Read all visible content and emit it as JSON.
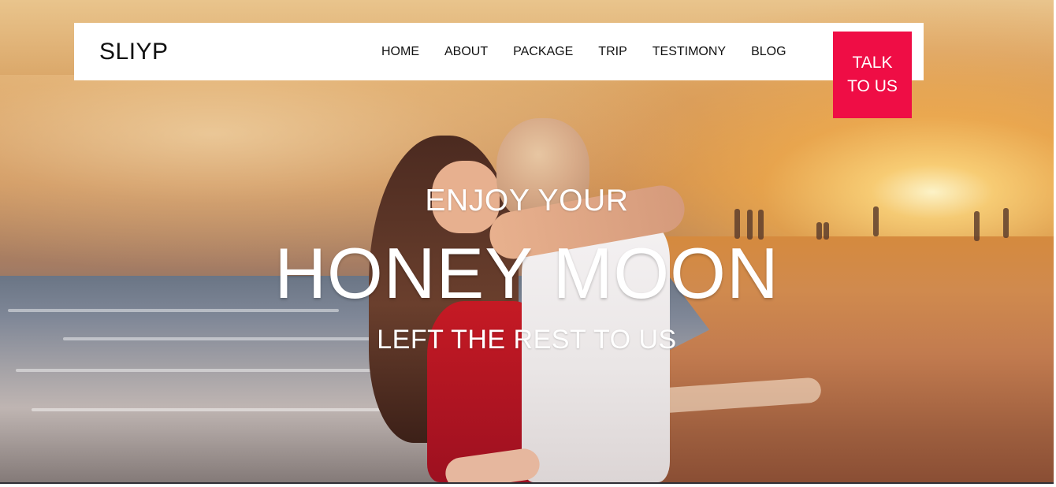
{
  "brand": {
    "name": "SLIYP"
  },
  "navigation": {
    "items": [
      {
        "label": "HOME"
      },
      {
        "label": "ABOUT"
      },
      {
        "label": "PACKAGE"
      },
      {
        "label": "TRIP"
      },
      {
        "label": "TESTIMONY"
      },
      {
        "label": "BLOG"
      }
    ]
  },
  "cta": {
    "label": "TALK TO US"
  },
  "hero": {
    "kicker": "ENJOY YOUR",
    "title": "HONEY MOON",
    "subtitle": "LEFT THE REST TO US"
  },
  "colors": {
    "accent": "#EF0D45",
    "text_on_hero": "#FFFFFF",
    "nav_text": "#111111",
    "nav_background": "#FFFFFF"
  }
}
